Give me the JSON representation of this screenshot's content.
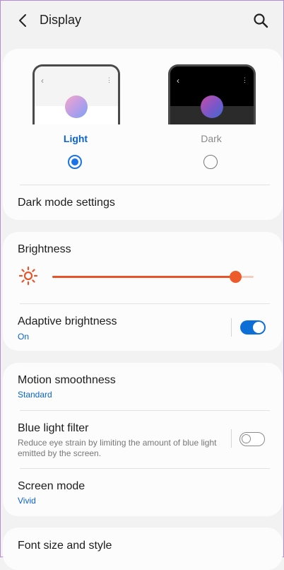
{
  "header": {
    "title": "Display",
    "back_icon": "back-arrow-icon",
    "search_icon": "search-icon"
  },
  "theme": {
    "options": [
      {
        "label": "Light",
        "selected": true
      },
      {
        "label": "Dark",
        "selected": false
      }
    ],
    "dark_mode_settings_label": "Dark mode settings"
  },
  "brightness": {
    "label": "Brightness",
    "level_fraction": 0.91,
    "accent_color": "#e5542a",
    "adaptive": {
      "label": "Adaptive brightness",
      "status": "On",
      "enabled": true
    }
  },
  "motion": {
    "label": "Motion smoothness",
    "value": "Standard"
  },
  "blue_light": {
    "label": "Blue light filter",
    "description": "Reduce eye strain by limiting the amount of blue light emitted by the screen.",
    "enabled": false
  },
  "screen_mode": {
    "label": "Screen mode",
    "value": "Vivid"
  },
  "font": {
    "label": "Font size and style"
  },
  "colors": {
    "accent": "#0b63ce",
    "toggle_on": "#0d6fd6"
  }
}
